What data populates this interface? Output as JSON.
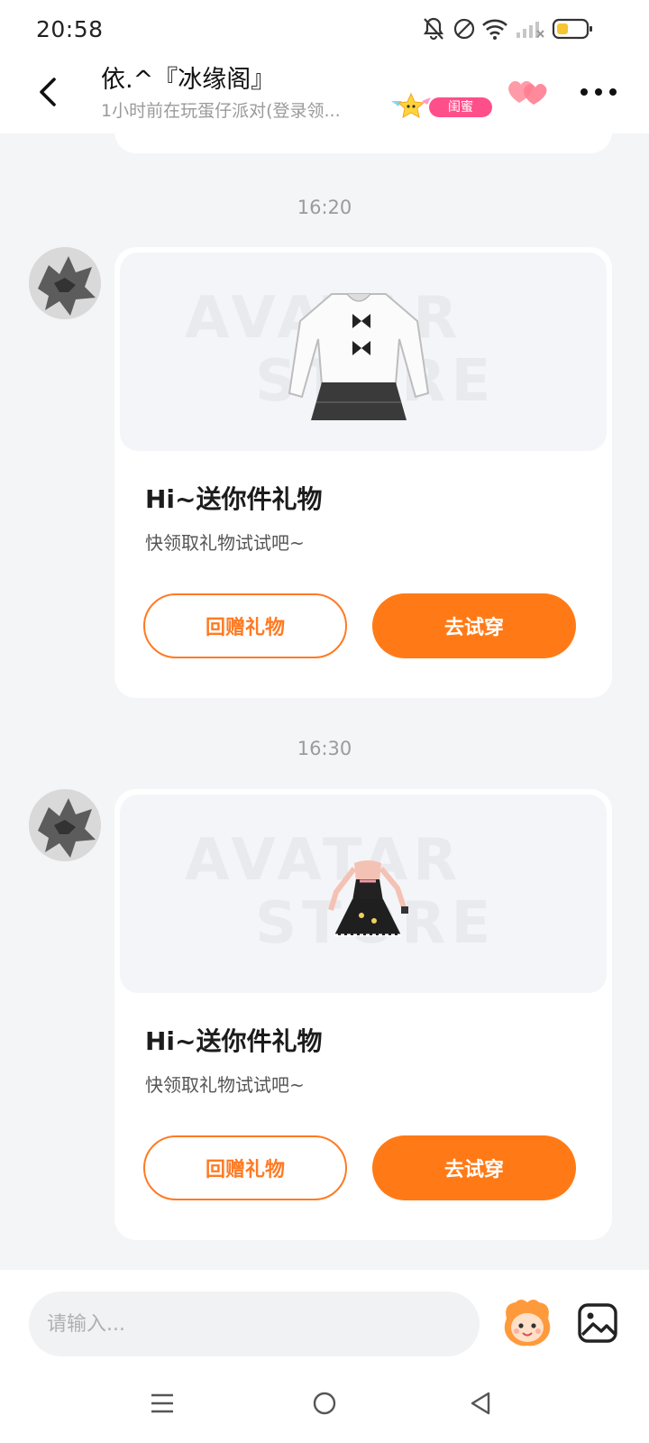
{
  "status_bar": {
    "time": "20:58",
    "icons": [
      "bell-muted-icon",
      "do-not-disturb-icon",
      "wifi-icon",
      "signal-icon",
      "battery-icon"
    ],
    "battery_color": "#f7c531"
  },
  "header": {
    "title": "依.^『冰缘阁』",
    "subtitle": "1小时前在玩蛋仔派对(登录领...",
    "badge_label": "闺蜜",
    "badge_color": "#ff4f8b",
    "heart_color": "#ff8a9e"
  },
  "messages": [
    {
      "timestamp": "16:20",
      "watermark_top": "AVATAR",
      "watermark_bottom": "STORE",
      "gift_title": "Hi~送你件礼物",
      "gift_desc": "快领取礼物试试吧~",
      "return_label": "回赠礼物",
      "try_label": "去试穿",
      "item": "white-sweater-skirt-outfit"
    },
    {
      "timestamp": "16:30",
      "watermark_top": "AVATAR",
      "watermark_bottom": "STORE",
      "gift_title": "Hi~送你件礼物",
      "gift_desc": "快领取礼物试试吧~",
      "return_label": "回赠礼物",
      "try_label": "去试穿",
      "item": "black-dress-outfit"
    }
  ],
  "input": {
    "placeholder": "请输入..."
  },
  "theme": {
    "accent": "#ff7a16"
  }
}
